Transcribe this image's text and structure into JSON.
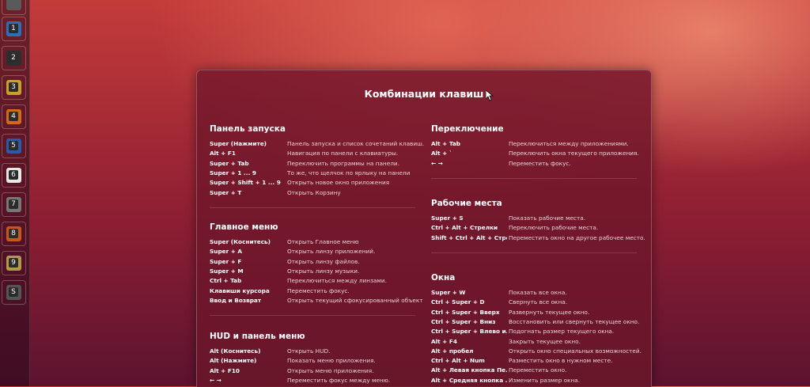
{
  "launcher": {
    "items": [
      {
        "icon": "dash-icon",
        "num": ""
      },
      {
        "icon": "app-icon",
        "num": "1"
      },
      {
        "icon": "terminal-icon",
        "num": "2"
      },
      {
        "icon": "app-icon",
        "num": "3"
      },
      {
        "icon": "app-icon",
        "num": "4"
      },
      {
        "icon": "firefox-icon",
        "num": "5"
      },
      {
        "icon": "document-icon",
        "num": "6"
      },
      {
        "icon": "settings-icon",
        "num": "7"
      },
      {
        "icon": "app-icon",
        "num": "8"
      },
      {
        "icon": "app-icon",
        "num": "9"
      },
      {
        "icon": "workspace-switcher-icon",
        "num": "S"
      }
    ]
  },
  "overlay": {
    "title": "Комбинации клавиш",
    "left": [
      {
        "title": "Панель запуска",
        "rows": [
          {
            "key": "Super (Нажмите)",
            "desc": "Панель запуска и список сочетаний клавиш."
          },
          {
            "key": "Alt + F1",
            "desc": "Навигация по панели с клавиатуры."
          },
          {
            "key": "Super + Tab",
            "desc": "Переключить программы на панели."
          },
          {
            "key": "Super + 1 ... 9",
            "desc": "То же, что щелчок по ярлыку на панели"
          },
          {
            "key": "Super + Shift + 1 ... 9",
            "desc": "Открыть новое окно приложения"
          },
          {
            "key": "Super + T",
            "desc": "Открыть Корзину"
          }
        ]
      },
      {
        "title": "Главное меню",
        "rows": [
          {
            "key": "Super (Коснитесь)",
            "desc": "Открыть Главное меню"
          },
          {
            "key": "Super + A",
            "desc": "Открыть линзу приложений."
          },
          {
            "key": "Super + F",
            "desc": "Открыть линзу файлов."
          },
          {
            "key": "Super + M",
            "desc": "Открыть линзу музыки."
          },
          {
            "key": "Ctrl + Tab",
            "desc": "Переключиться между линзами."
          },
          {
            "key": "Клавиши курсора",
            "desc": "Переместить фокус."
          },
          {
            "key": "Ввод и Возврат",
            "desc": "Открыть текущий сфокусированный объект"
          }
        ]
      },
      {
        "title": "HUD и панель меню",
        "rows": [
          {
            "key": "Alt (Коснитесь)",
            "desc": "Открыть HUD."
          },
          {
            "key": "Alt (Нажмите)",
            "desc": "Показать меню приложения."
          },
          {
            "key": "Alt + F10",
            "desc": "Открыть меню приложения."
          },
          {
            "key": "← →",
            "desc": "Переместить фокус между меню."
          }
        ]
      }
    ],
    "right": [
      {
        "title": "Переключение",
        "rows": [
          {
            "key": "Alt + Tab",
            "desc": "Переключиться между приложениями."
          },
          {
            "key": "Alt + `",
            "desc": "Переключить окна текущего приложения."
          },
          {
            "key": "← →",
            "desc": "Переместить фокус."
          }
        ]
      },
      {
        "title": "Рабочие места",
        "rows": [
          {
            "key": "Super + S",
            "desc": "Показать рабочие места."
          },
          {
            "key": "Ctrl + Alt + Стрелки",
            "desc": "Переключить рабочие места."
          },
          {
            "key": "Shift + Ctrl + Alt + Стре...",
            "desc": "Переместить окно на другое рабочее место."
          }
        ]
      },
      {
        "title": "Окна",
        "rows": [
          {
            "key": "Super + W",
            "desc": "Показать все окна."
          },
          {
            "key": "Ctrl + Super + D",
            "desc": "Свернуть все окна."
          },
          {
            "key": "Ctrl + Super + Вверх",
            "desc": "Развернуть текущее окно."
          },
          {
            "key": "Ctrl + Super + Вниз",
            "desc": "Восстановить или свернуть текущее окно."
          },
          {
            "key": "Ctrl + Super + Влево ил...",
            "desc": "Подогнать размер текущего окна."
          },
          {
            "key": "Alt + F4",
            "desc": "Закрыть текущее окно."
          },
          {
            "key": "Alt + пробел",
            "desc": "Открыть окно специальных возможностей."
          },
          {
            "key": "Ctrl + Alt + Num",
            "desc": "Разместить окно в нужном месте."
          },
          {
            "key": "Alt + Левая кнопка Пе...",
            "desc": "Переместить окно."
          },
          {
            "key": "Alt + Средняя кнопка ...",
            "desc": "Изменить размер окна."
          }
        ]
      }
    ]
  }
}
